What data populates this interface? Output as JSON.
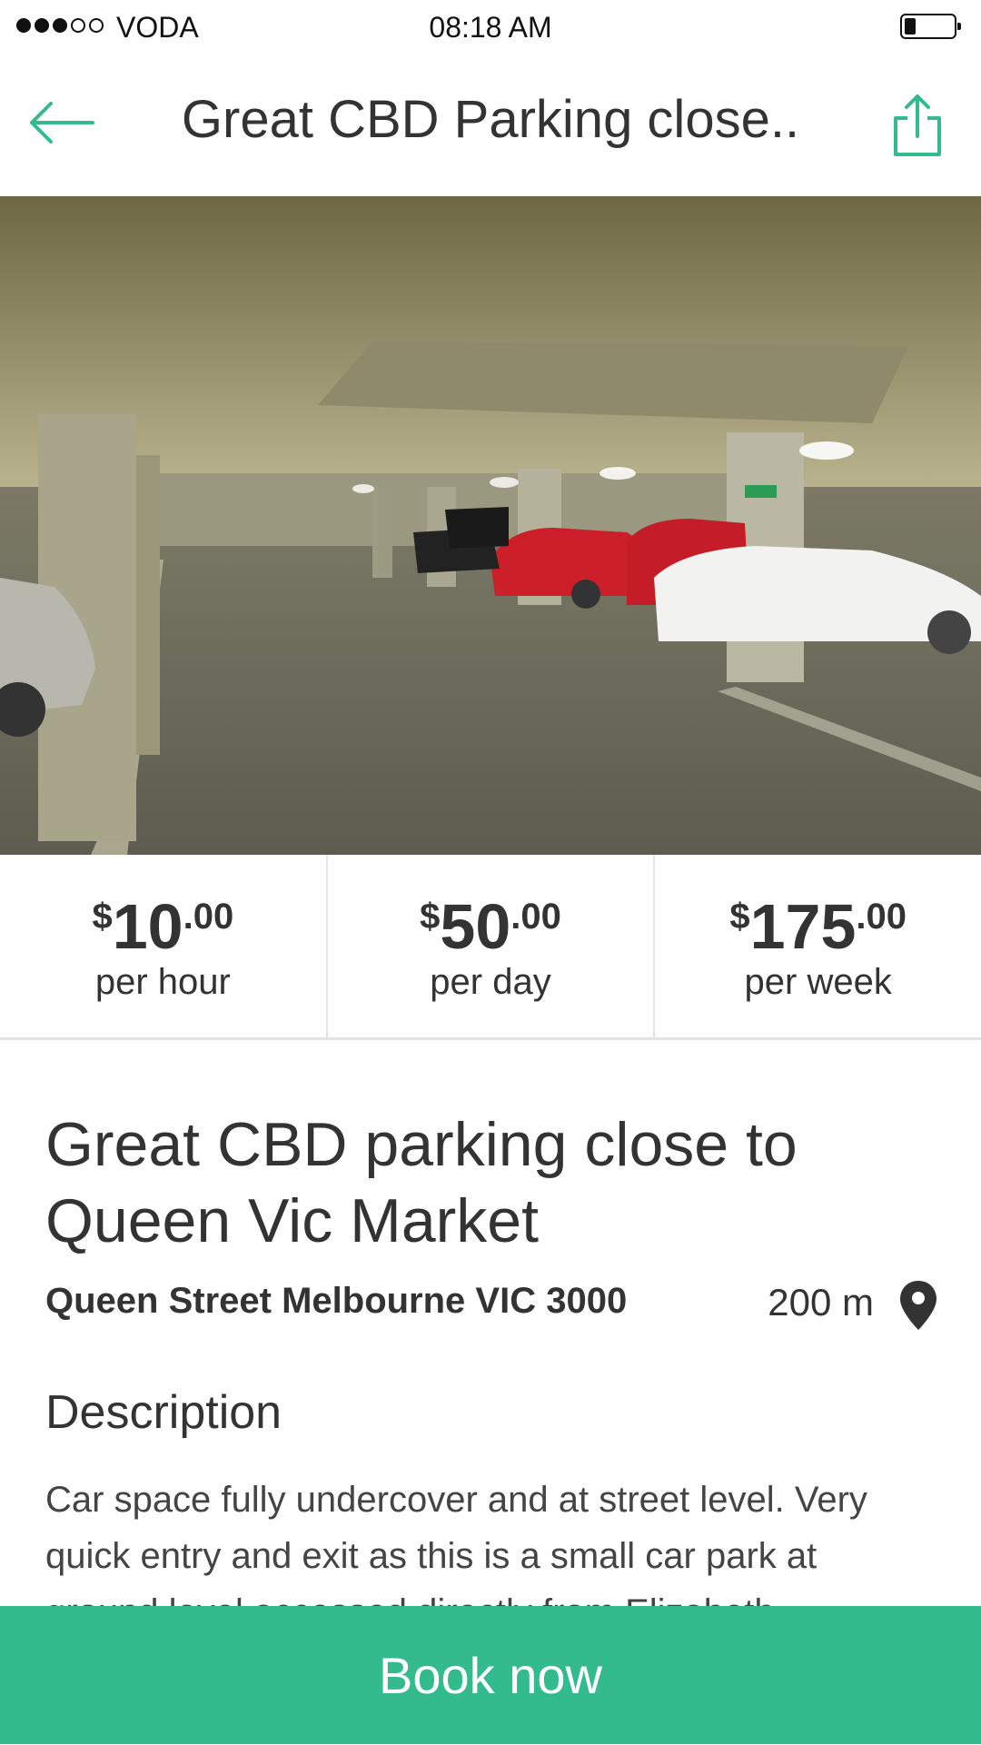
{
  "status_bar": {
    "carrier": "VODA",
    "time": "08:18 AM",
    "signal_bars": 3,
    "signal_max": 5
  },
  "nav": {
    "title": "Great CBD Parking close..",
    "accent_color": "#33bb8d"
  },
  "prices": [
    {
      "currency": "$",
      "whole": "10",
      "cents": ".00",
      "period": "per hour"
    },
    {
      "currency": "$",
      "whole": "50",
      "cents": ".00",
      "period": "per day"
    },
    {
      "currency": "$",
      "whole": "175",
      "cents": ".00",
      "period": "per week"
    }
  ],
  "listing": {
    "title": "Great CBD parking close to Queen Vic Market",
    "address": "Queen Street Melbourne VIC 3000",
    "distance": "200 m"
  },
  "description": {
    "heading": "Description",
    "body": "Car space fully undercover and at street level. Very quick entry and exit as this is a small car park at ground level accessed directly from Elizabeth"
  },
  "cta": {
    "label": "Book now",
    "color": "#33bb8d"
  },
  "icons": {
    "back": "arrow-left-icon",
    "share": "share-icon",
    "location": "map-pin-icon"
  }
}
